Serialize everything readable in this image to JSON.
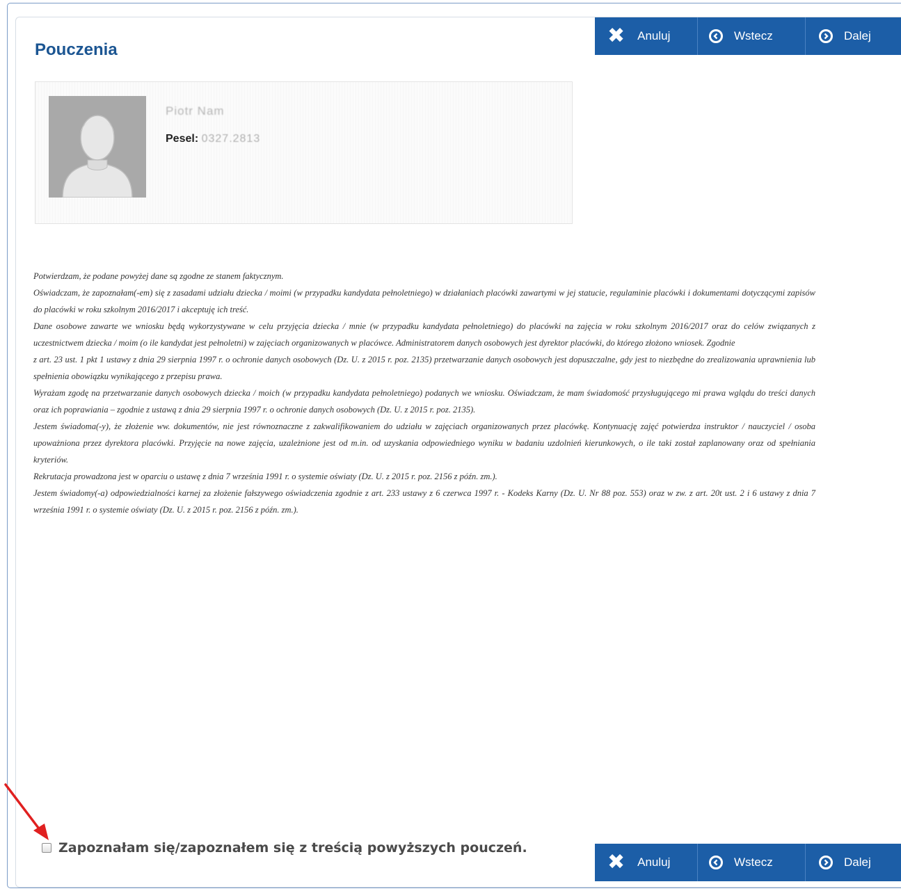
{
  "page": {
    "title": "Pouczenia"
  },
  "nav": {
    "cancel_label": "Anuluj",
    "back_label": "Wstecz",
    "next_label": "Dalej"
  },
  "profile": {
    "name": "Piotr Nam",
    "pesel_label": "Pesel:",
    "pesel_value": "0327.2813"
  },
  "instructions": [
    "Potwierdzam, że podane powyżej dane są zgodne ze stanem faktycznym.",
    "Oświadczam, że zapoznałam(-em) się z zasadami udziału dziecka / moimi (w przypadku kandydata pełnoletniego) w działaniach placówki zawartymi w jej statucie, regulaminie placówki i dokumentami dotyczącymi zapisów do placówki w roku szkolnym 2016/2017 i akceptuję ich treść.",
    "Dane osobowe zawarte we wniosku będą wykorzystywane w celu przyjęcia dziecka / mnie (w przypadku kandydata pełnoletniego) do placówki na zajęcia w roku szkolnym 2016/2017 oraz do celów związanych z uczestnictwem dziecka / moim (o ile kandydat jest pełnoletni) w zajęciach organizowanych w placówce. Administratorem danych osobowych jest dyrektor placówki, do którego złożono wniosek. Zgodnie",
    "z art. 23 ust. 1 pkt 1 ustawy z dnia 29 sierpnia 1997 r. o ochronie danych osobowych (Dz. U. z 2015 r. poz. 2135) przetwarzanie danych osobowych jest dopuszczalne, gdy jest to niezbędne do zrealizowania uprawnienia lub spełnienia obowiązku wynikającego z przepisu prawa.",
    "Wyrażam zgodę na przetwarzanie danych osobowych dziecka / moich (w przypadku kandydata pełnoletniego) podanych we wniosku. Oświadczam, że mam świadomość przysługującego mi prawa wglądu do treści danych oraz ich poprawiania – zgodnie z ustawą z dnia 29 sierpnia 1997 r. o ochronie danych osobowych (Dz. U. z 2015 r. poz. 2135).",
    "Jestem świadoma(-y), że złożenie ww. dokumentów, nie jest równoznaczne z zakwalifikowaniem do udziału w zajęciach organizowanych przez placówkę. Kontynuację zajęć potwierdza  instruktor / nauczyciel / osoba upoważniona przez dyrektora placówki. Przyjęcie na nowe zajęcia, uzależnione jest od m.in. od uzyskania odpowiedniego wyniku w badaniu uzdolnień kierunkowych, o ile taki został zaplanowany oraz od spełniania kryteriów.",
    "Rekrutacja prowadzona jest w oparciu o ustawę z dnia 7 września 1991 r. o systemie oświaty (Dz. U. z 2015 r. poz. 2156 z późn. zm.).",
    "Jestem świadomy(-a) odpowiedzialności karnej za złożenie fałszywego oświadczenia zgodnie z art. 233 ustawy z 6 czerwca 1997 r. - Kodeks Karny (Dz. U. Nr 88 poz. 553) oraz w zw. z art. 20t ust. 2 i 6 ustawy z dnia 7 września 1991 r. o systemie oświaty (Dz. U. z 2015 r. poz. 2156 z późn. zm.)."
  ],
  "confirm": {
    "label": "Zapoznałam się/zapoznałem się z treścią powyższych pouczeń.",
    "checked": false
  },
  "colors": {
    "nav_bg": "#1c5ea7",
    "title": "#1b5592",
    "annotation_arrow": "#e02020"
  },
  "icons": {
    "cancel": "x-icon",
    "back": "circle-chevron-left-icon",
    "next": "circle-chevron-right-icon",
    "avatar": "user-silhouette-icon"
  }
}
